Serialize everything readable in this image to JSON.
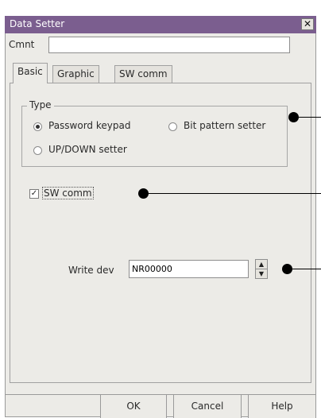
{
  "window": {
    "title": "Data Setter",
    "close_glyph": "✕"
  },
  "comment": {
    "label": "Cmnt",
    "value": ""
  },
  "tabs": [
    {
      "label": "Basic",
      "active": true
    },
    {
      "label": "Graphic",
      "active": false
    },
    {
      "label": "SW comm",
      "active": false
    }
  ],
  "type_group": {
    "legend": "Type",
    "options": [
      {
        "label": "Password keypad",
        "selected": true
      },
      {
        "label": "Bit pattern setter",
        "selected": false
      },
      {
        "label": "UP/DOWN setter",
        "selected": false
      }
    ]
  },
  "sw_comm": {
    "label": "SW comm",
    "checked": true,
    "check_glyph": "✓"
  },
  "write_dev": {
    "label": "Write dev",
    "value": "NR00000",
    "up_glyph": "▲",
    "down_glyph": "▼"
  },
  "buttons": {
    "ok": "OK",
    "cancel": "Cancel",
    "help": "Help"
  },
  "colors": {
    "title_bar": "#7b5e8f",
    "dialog_bg": "#ecebe7",
    "marker": "#000000"
  }
}
